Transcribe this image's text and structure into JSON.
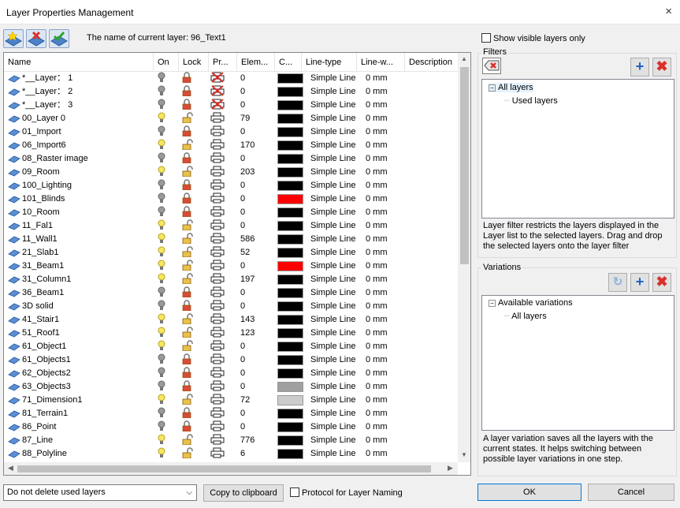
{
  "window": {
    "title": "Layer Properties Management",
    "close_glyph": "×"
  },
  "toolbar": {
    "current_layer_label": "The name of current layer: 96_Text1",
    "buttons": [
      "new-layer-icon",
      "delete-layer-icon",
      "set-current-layer-icon"
    ]
  },
  "show_visible_label": "Show visible layers only",
  "columns": [
    "Name",
    "On",
    "Lock",
    "Pr...",
    "Elem...",
    "C...",
    "Line-type",
    "Line-w...",
    "Description"
  ],
  "layers": [
    {
      "name": "*__Layer： 1",
      "on": false,
      "locked": true,
      "print": false,
      "elements": "0",
      "color": "#000000",
      "linetype": "Simple Line",
      "linewidth": "0 mm"
    },
    {
      "name": "*__Layer： 2",
      "on": false,
      "locked": true,
      "print": false,
      "elements": "0",
      "color": "#000000",
      "linetype": "Simple Line",
      "linewidth": "0 mm"
    },
    {
      "name": "*__Layer： 3",
      "on": false,
      "locked": true,
      "print": false,
      "elements": "0",
      "color": "#000000",
      "linetype": "Simple Line",
      "linewidth": "0 mm"
    },
    {
      "name": "00_Layer 0",
      "on": true,
      "locked": false,
      "print": true,
      "elements": "79",
      "color": "#000000",
      "linetype": "Simple Line",
      "linewidth": "0 mm"
    },
    {
      "name": "01_Import",
      "on": false,
      "locked": true,
      "print": true,
      "elements": "0",
      "color": "#000000",
      "linetype": "Simple Line",
      "linewidth": "0 mm"
    },
    {
      "name": "06_Import6",
      "on": true,
      "locked": false,
      "print": true,
      "elements": "170",
      "color": "#000000",
      "linetype": "Simple Line",
      "linewidth": "0 mm"
    },
    {
      "name": "08_Raster image",
      "on": false,
      "locked": true,
      "print": true,
      "elements": "0",
      "color": "#000000",
      "linetype": "Simple Line",
      "linewidth": "0 mm"
    },
    {
      "name": "09_Room",
      "on": true,
      "locked": false,
      "print": true,
      "elements": "203",
      "color": "#000000",
      "linetype": "Simple Line",
      "linewidth": "0 mm"
    },
    {
      "name": "100_Lighting",
      "on": false,
      "locked": true,
      "print": true,
      "elements": "0",
      "color": "#000000",
      "linetype": "Simple Line",
      "linewidth": "0 mm"
    },
    {
      "name": "101_Blinds",
      "on": false,
      "locked": true,
      "print": true,
      "elements": "0",
      "color": "#ff0000",
      "linetype": "Simple Line",
      "linewidth": "0 mm"
    },
    {
      "name": "10_Room",
      "on": false,
      "locked": true,
      "print": true,
      "elements": "0",
      "color": "#000000",
      "linetype": "Simple Line",
      "linewidth": "0 mm"
    },
    {
      "name": "11_Fal1",
      "on": true,
      "locked": false,
      "print": true,
      "elements": "0",
      "color": "#000000",
      "linetype": "Simple Line",
      "linewidth": "0 mm"
    },
    {
      "name": "11_Wall1",
      "on": true,
      "locked": false,
      "print": true,
      "elements": "586",
      "color": "#000000",
      "linetype": "Simple Line",
      "linewidth": "0 mm"
    },
    {
      "name": "21_Slab1",
      "on": true,
      "locked": false,
      "print": true,
      "elements": "52",
      "color": "#000000",
      "linetype": "Simple Line",
      "linewidth": "0 mm"
    },
    {
      "name": "31_Beam1",
      "on": true,
      "locked": false,
      "print": true,
      "elements": "0",
      "color": "#ff0000",
      "linetype": "Simple Line",
      "linewidth": "0 mm"
    },
    {
      "name": "31_Column1",
      "on": true,
      "locked": false,
      "print": true,
      "elements": "197",
      "color": "#000000",
      "linetype": "Simple Line",
      "linewidth": "0 mm"
    },
    {
      "name": "36_Beam1",
      "on": false,
      "locked": true,
      "print": true,
      "elements": "0",
      "color": "#000000",
      "linetype": "Simple Line",
      "linewidth": "0 mm"
    },
    {
      "name": "3D solid",
      "on": false,
      "locked": true,
      "print": true,
      "elements": "0",
      "color": "#000000",
      "linetype": "Simple Line",
      "linewidth": "0 mm"
    },
    {
      "name": "41_Stair1",
      "on": true,
      "locked": false,
      "print": true,
      "elements": "143",
      "color": "#000000",
      "linetype": "Simple Line",
      "linewidth": "0 mm"
    },
    {
      "name": "51_Roof1",
      "on": true,
      "locked": false,
      "print": true,
      "elements": "123",
      "color": "#000000",
      "linetype": "Simple Line",
      "linewidth": "0 mm"
    },
    {
      "name": "61_Object1",
      "on": true,
      "locked": false,
      "print": true,
      "elements": "0",
      "color": "#000000",
      "linetype": "Simple Line",
      "linewidth": "0 mm"
    },
    {
      "name": "61_Objects1",
      "on": false,
      "locked": true,
      "print": true,
      "elements": "0",
      "color": "#000000",
      "linetype": "Simple Line",
      "linewidth": "0 mm"
    },
    {
      "name": "62_Objects2",
      "on": false,
      "locked": true,
      "print": true,
      "elements": "0",
      "color": "#000000",
      "linetype": "Simple Line",
      "linewidth": "0 mm"
    },
    {
      "name": "63_Objects3",
      "on": false,
      "locked": true,
      "print": true,
      "elements": "0",
      "color": "#a0a0a0",
      "linetype": "Simple Line",
      "linewidth": "0 mm"
    },
    {
      "name": "71_Dimension1",
      "on": true,
      "locked": false,
      "print": true,
      "elements": "72",
      "color": "#cccccc",
      "linetype": "Simple Line",
      "linewidth": "0 mm"
    },
    {
      "name": "81_Terrain1",
      "on": false,
      "locked": true,
      "print": true,
      "elements": "0",
      "color": "#000000",
      "linetype": "Simple Line",
      "linewidth": "0 mm"
    },
    {
      "name": "86_Point",
      "on": false,
      "locked": true,
      "print": true,
      "elements": "0",
      "color": "#000000",
      "linetype": "Simple Line",
      "linewidth": "0 mm"
    },
    {
      "name": "87_Line",
      "on": true,
      "locked": false,
      "print": true,
      "elements": "776",
      "color": "#000000",
      "linetype": "Simple Line",
      "linewidth": "0 mm"
    },
    {
      "name": "88_Polyline",
      "on": true,
      "locked": false,
      "print": true,
      "elements": "6",
      "color": "#000000",
      "linetype": "Simple Line",
      "linewidth": "0 mm"
    }
  ],
  "filters": {
    "label": "Filters",
    "tree_root": "All layers",
    "tree_child": "Used layers",
    "description": [
      "Layer filter restricts the layers displayed in the",
      "Layer list to the selected layers. Drag and drop",
      "the selected layers onto the layer filter"
    ]
  },
  "variations": {
    "label": "Variations",
    "tree_root": "Available variations",
    "tree_child": "All layers",
    "description": [
      "A layer variation saves all the layers with the",
      "current states. It helps switching between",
      "possible layer variations in one step."
    ]
  },
  "bottom": {
    "delete_mode": "Do not delete used layers",
    "copy_button": "Copy to clipboard",
    "protocol_label": "Protocol for Layer Naming",
    "ok_button": "OK",
    "cancel_button": "Cancel"
  },
  "colors": {
    "accent": "#0078d7",
    "plus": "#1f63c6",
    "delete": "#d9302b"
  }
}
